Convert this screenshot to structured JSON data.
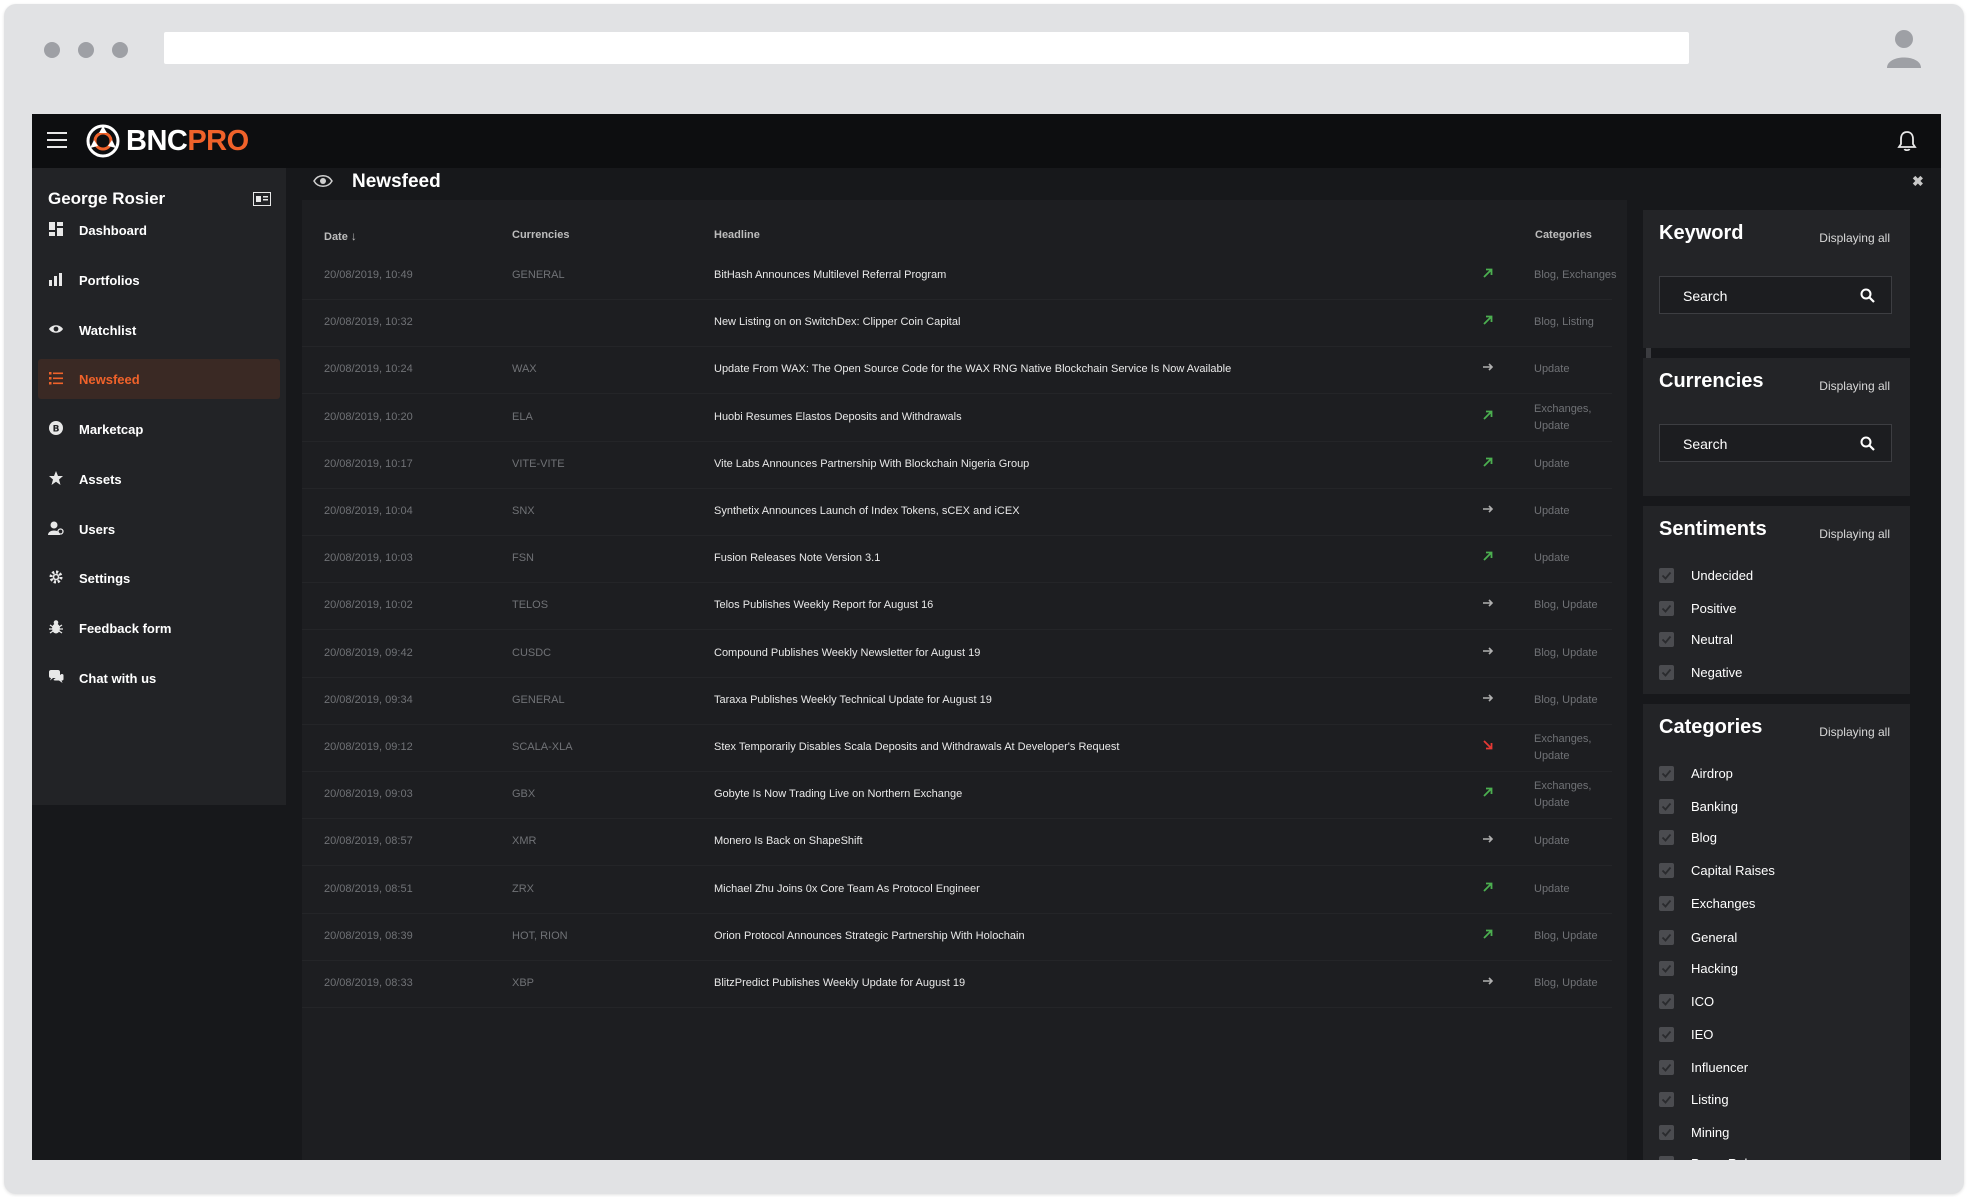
{
  "app": {
    "logo": {
      "part1": "BNC",
      "part2": "PRO"
    }
  },
  "user": {
    "name": "George Rosier"
  },
  "sidebar": {
    "items": [
      {
        "label": "Dashboard",
        "icon": "dashboard-icon"
      },
      {
        "label": "Portfolios",
        "icon": "bar-chart-icon"
      },
      {
        "label": "Watchlist",
        "icon": "eye-icon"
      },
      {
        "label": "Newsfeed",
        "icon": "list-icon",
        "active": true
      },
      {
        "label": "Marketcap",
        "icon": "bitcoin-icon"
      },
      {
        "label": "Assets",
        "icon": "star-icon"
      },
      {
        "label": "Users",
        "icon": "user-icon"
      },
      {
        "label": "Settings",
        "icon": "gear-icon"
      },
      {
        "label": "Feedback form",
        "icon": "bug-icon"
      },
      {
        "label": "Chat with us",
        "icon": "chat-icon"
      }
    ]
  },
  "main": {
    "title": "Newsfeed",
    "columns": {
      "date": "Date",
      "currencies": "Currencies",
      "headline": "Headline",
      "categories": "Categories"
    },
    "rows": [
      {
        "date": "20/08/2019, 10:49",
        "currencies": "GENERAL",
        "headline": "BitHash Announces Multilevel Referral Program",
        "sentiment": "positive",
        "categories": [
          "Blog, Exchanges"
        ]
      },
      {
        "date": "20/08/2019, 10:32",
        "currencies": "",
        "headline": "New Listing on on SwitchDex: Clipper Coin Capital",
        "sentiment": "positive",
        "categories": [
          "Blog, Listing"
        ]
      },
      {
        "date": "20/08/2019, 10:24",
        "currencies": "WAX",
        "headline": "Update From WAX: The Open Source Code for the WAX RNG Native Blockchain Service Is Now Available",
        "sentiment": "neutral",
        "categories": [
          "Update"
        ]
      },
      {
        "date": "20/08/2019, 10:20",
        "currencies": "ELA",
        "headline": "Huobi Resumes Elastos Deposits and Withdrawals",
        "sentiment": "positive",
        "categories": [
          "Exchanges,",
          "Update"
        ]
      },
      {
        "date": "20/08/2019, 10:17",
        "currencies": "VITE-VITE",
        "headline": "Vite Labs Announces Partnership With Blockchain Nigeria Group",
        "sentiment": "positive",
        "categories": [
          "Update"
        ]
      },
      {
        "date": "20/08/2019, 10:04",
        "currencies": "SNX",
        "headline": "Synthetix Announces Launch of Index Tokens, sCEX and iCEX",
        "sentiment": "neutral",
        "categories": [
          "Update"
        ]
      },
      {
        "date": "20/08/2019, 10:03",
        "currencies": "FSN",
        "headline": "Fusion Releases Note Version 3.1",
        "sentiment": "positive",
        "categories": [
          "Update"
        ]
      },
      {
        "date": "20/08/2019, 10:02",
        "currencies": "TELOS",
        "headline": "Telos Publishes Weekly Report for August 16",
        "sentiment": "neutral",
        "categories": [
          "Blog, Update"
        ]
      },
      {
        "date": "20/08/2019, 09:42",
        "currencies": "CUSDC",
        "headline": "Compound Publishes Weekly Newsletter for August 19",
        "sentiment": "neutral",
        "categories": [
          "Blog, Update"
        ]
      },
      {
        "date": "20/08/2019, 09:34",
        "currencies": "GENERAL",
        "headline": "Taraxa Publishes Weekly Technical Update for August 19",
        "sentiment": "neutral",
        "categories": [
          "Blog, Update"
        ]
      },
      {
        "date": "20/08/2019, 09:12",
        "currencies": "SCALA-XLA",
        "headline": "Stex Temporarily Disables Scala Deposits and Withdrawals At Developer's Request",
        "sentiment": "negative",
        "categories": [
          "Exchanges,",
          "Update"
        ]
      },
      {
        "date": "20/08/2019, 09:03",
        "currencies": "GBX",
        "headline": "Gobyte Is Now Trading Live on Northern Exchange",
        "sentiment": "positive",
        "categories": [
          "Exchanges,",
          "Update"
        ]
      },
      {
        "date": "20/08/2019, 08:57",
        "currencies": "XMR",
        "headline": "Monero Is Back on ShapeShift",
        "sentiment": "neutral",
        "categories": [
          "Update"
        ]
      },
      {
        "date": "20/08/2019, 08:51",
        "currencies": "ZRX",
        "headline": "Michael Zhu Joins 0x Core Team As Protocol Engineer",
        "sentiment": "positive",
        "categories": [
          "Update"
        ]
      },
      {
        "date": "20/08/2019, 08:39",
        "currencies": "HOT, RION",
        "headline": "Orion Protocol Announces Strategic Partnership With Holochain",
        "sentiment": "positive",
        "categories": [
          "Blog, Update"
        ]
      },
      {
        "date": "20/08/2019, 08:33",
        "currencies": "XBP",
        "headline": "BlitzPredict Publishes Weekly Update for August 19",
        "sentiment": "neutral",
        "categories": [
          "Blog, Update"
        ]
      }
    ]
  },
  "filters": {
    "keyword": {
      "title": "Keyword",
      "displaying": "Displaying all",
      "placeholder": "Search"
    },
    "currencies": {
      "title": "Currencies",
      "displaying": "Displaying all",
      "placeholder": "Search"
    },
    "sentiments": {
      "title": "Sentiments",
      "displaying": "Displaying all",
      "options": [
        "Undecided",
        "Positive",
        "Neutral",
        "Negative"
      ]
    },
    "categories": {
      "title": "Categories",
      "displaying": "Displaying all",
      "options": [
        "Airdrop",
        "Banking",
        "Blog",
        "Capital Raises",
        "Exchanges",
        "General",
        "Hacking",
        "ICO",
        "IEO",
        "Influencer",
        "Listing",
        "Mining",
        "Press Release"
      ]
    }
  },
  "colors": {
    "accent": "#f0622a",
    "positive": "#4caf50",
    "negative": "#e53935",
    "neutral": "#b0b0b0"
  }
}
